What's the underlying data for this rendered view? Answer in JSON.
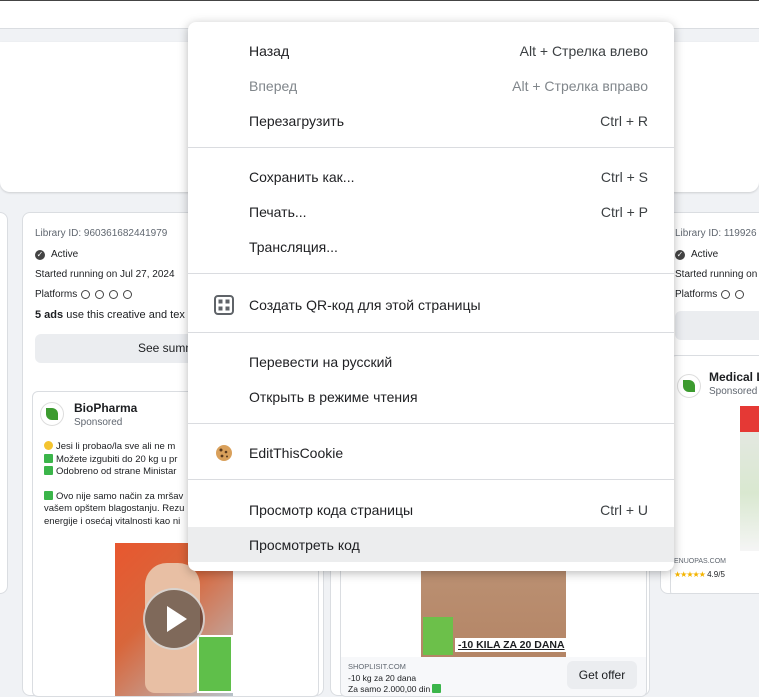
{
  "menu": {
    "items": [
      {
        "label": "Назад",
        "shortcut": "Alt + Стрелка влево"
      },
      {
        "label": "Вперед",
        "shortcut": "Alt + Стрелка вправо"
      },
      {
        "label": "Перезагрузить",
        "shortcut": "Ctrl + R"
      },
      {
        "label": "Сохранить как...",
        "shortcut": "Ctrl + S"
      },
      {
        "label": "Печать...",
        "shortcut": "Ctrl + P"
      },
      {
        "label": "Трансляция..."
      },
      {
        "label": "Создать QR-код для этой страницы"
      },
      {
        "label": "Перевести на русский"
      },
      {
        "label": "Открыть в режиме чтения"
      },
      {
        "label": "EditThisCookie"
      },
      {
        "label": "Просмотр кода страницы",
        "shortcut": "Ctrl + U"
      },
      {
        "label": "Просмотреть код"
      }
    ]
  },
  "card1": {
    "library_id": "Library ID: 960361682441979",
    "status": "Active",
    "started": "Started running on Jul 27, 2024",
    "platforms": "Platforms",
    "ads_count": "5 ads",
    "ads_text": " use this creative and tex",
    "see_summary": "See summary",
    "advertiser": "BioPharma",
    "sponsored": "Sponsored",
    "lines": [
      "Jesi li probao/la sve ali ne m",
      "Možete izgubiti do 20 kg u pr",
      "Odobreno od strane Ministar",
      "Ovo nije samo način za mršav",
      "vašem opštem blagostanju. Rezu",
      "energije i osećaj vitalnosti kao ni"
    ]
  },
  "card2": {
    "banner": "-10 KILA ZA 20 DANA",
    "domain": "SHOPLISIT.COM",
    "line1": "-10 kg za 20 dana",
    "line2": "Za samo 2.000,00 din",
    "cta": "Get offer"
  },
  "card3": {
    "library_id": "Library ID: 119926",
    "status": "Active",
    "started": "Started running on",
    "platforms": "Platforms",
    "advertiser": "Medical L",
    "sponsored": "Sponsored",
    "domain": "ENUOPAS.COM",
    "rating": "4.9/5"
  }
}
